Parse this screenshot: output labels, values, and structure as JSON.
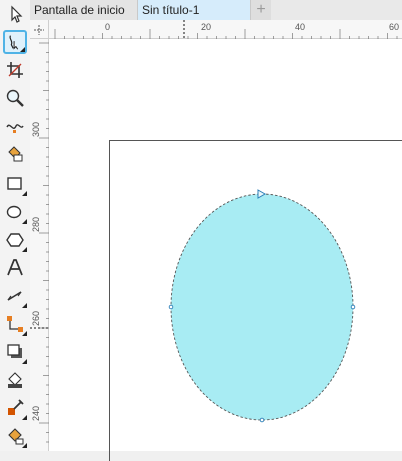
{
  "tabs": {
    "start": "Pantalla de inicio",
    "document": "Sin título-1",
    "add": "+"
  },
  "ruler": {
    "horizontal_labels": [
      "0",
      "20",
      "40",
      "60"
    ],
    "vertical_labels": [
      "300",
      "280",
      "260",
      "240"
    ]
  },
  "tools": [
    {
      "name": "pick-tool-icon"
    },
    {
      "name": "freehand-tool-icon",
      "active": true
    },
    {
      "name": "crop-tool-icon"
    },
    {
      "name": "zoom-tool-icon"
    },
    {
      "name": "curve-tool-icon"
    },
    {
      "name": "smart-fill-tool-icon"
    },
    {
      "name": "rectangle-tool-icon"
    },
    {
      "name": "ellipse-tool-icon"
    },
    {
      "name": "polygon-tool-icon"
    },
    {
      "name": "text-tool-icon"
    },
    {
      "name": "parallel-dimension-tool-icon"
    },
    {
      "name": "connector-tool-icon"
    },
    {
      "name": "drop-shadow-tool-icon"
    },
    {
      "name": "transparency-tool-icon"
    },
    {
      "name": "eyedropper-tool-icon"
    },
    {
      "name": "interactive-fill-tool-icon"
    }
  ],
  "colors": {
    "ellipse_fill": "#a8ecf3",
    "selection_accent": "#4fb3e6",
    "active_tab": "#d6ecfb"
  }
}
